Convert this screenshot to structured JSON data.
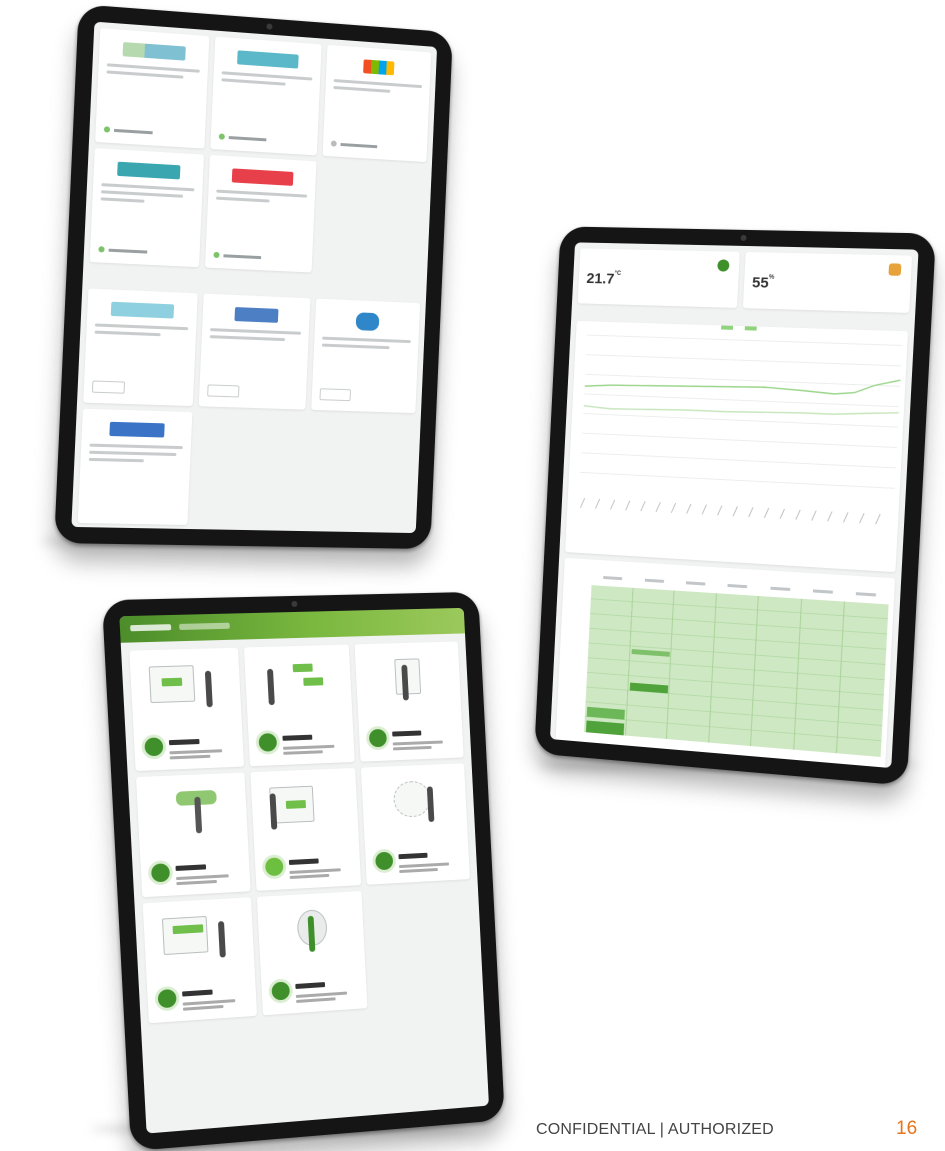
{
  "footer": {
    "confidential_text": "CONFIDENTIAL  | AUTHORIZED",
    "page_number": "16"
  },
  "dashboard": {
    "temperature_value": "21.7",
    "temperature_unit": "°C",
    "humidity_value": "55",
    "humidity_unit": "%"
  },
  "colors": {
    "accent_green": "#7cc36a",
    "dark_green": "#3f8f2b",
    "page_number_orange": "#e8731a",
    "humidity_icon": "#e8a23a"
  }
}
